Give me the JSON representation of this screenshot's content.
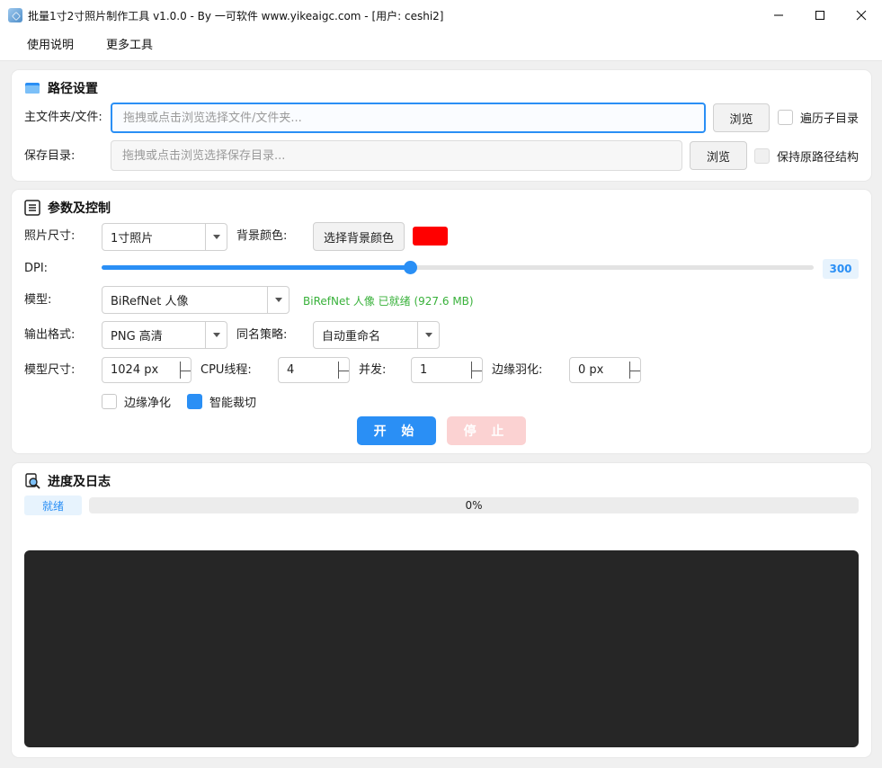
{
  "window": {
    "title": "批量1寸2寸照片制作工具 v1.0.0 - By 一可软件 www.yikeaigc.com - [用户: ceshi2]"
  },
  "menu": [
    "使用说明",
    "更多工具"
  ],
  "path_panel": {
    "title": "路径设置",
    "main_label": "主文件夹/文件:",
    "main_placeholder": "拖拽或点击浏览选择文件/文件夹...",
    "browse_label": "浏览",
    "recurse_label": "遍历子目录",
    "save_label": "保存目录:",
    "save_placeholder": "拖拽或点击浏览选择保存目录...",
    "save_browse_label": "浏览",
    "keep_structure_label": "保持原路径结构"
  },
  "params_panel": {
    "title": "参数及控制",
    "photo_size_label": "照片尺寸:",
    "photo_size_value": "1寸照片",
    "bg_color_label": "背景颜色:",
    "bg_color_button": "选择背景颜色",
    "bg_color": "#ff0000",
    "dpi_label": "DPI:",
    "dpi_value": "300",
    "dpi_fraction": 0.433,
    "model_label": "模型:",
    "model_value": "BiRefNet 人像",
    "model_status": "BiRefNet 人像 已就绪 (927.6 MB)",
    "format_label": "输出格式:",
    "format_value": "PNG 高清",
    "dup_label": "同名策略:",
    "dup_value": "自动重命名",
    "model_size_label": "模型尺寸:",
    "model_size_value": "1024 px",
    "cpu_label": "CPU线程:",
    "cpu_value": "4",
    "concurrency_label": "并发:",
    "concurrency_value": "1",
    "feather_label": "边缘羽化:",
    "feather_value": "0 px",
    "edge_clean_label": "边缘净化",
    "edge_clean_checked": false,
    "smart_crop_label": "智能裁切",
    "smart_crop_checked": true,
    "start_label": "开 始",
    "stop_label": "停 止"
  },
  "progress_panel": {
    "title": "进度及日志",
    "state": "就绪",
    "percent_text": "0%",
    "progress_fraction": 0
  },
  "colors": {
    "accent": "#2a8ff5",
    "success": "#38b13a",
    "log_bg": "#262626",
    "stop_disabled": "#fbd2d2"
  },
  "icons": [
    "app-icon",
    "minimize-icon",
    "maximize-icon",
    "close-icon",
    "folder-icon",
    "list-icon",
    "search-doc-icon"
  ]
}
